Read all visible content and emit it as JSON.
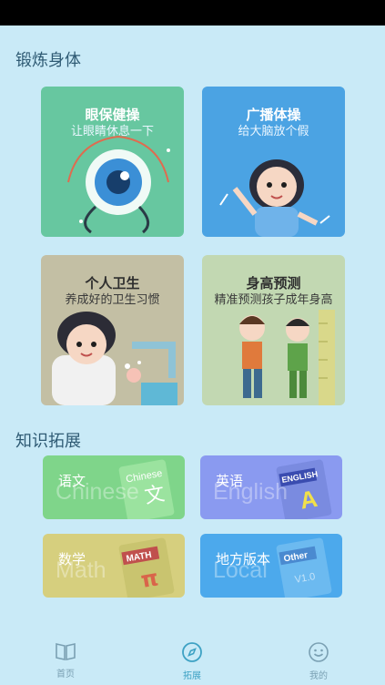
{
  "sections": {
    "exercise_title": "锻炼身体",
    "knowledge_title": "知识拓展"
  },
  "cards": [
    {
      "title": "眼保健操",
      "subtitle": "让眼睛休息一下",
      "color": "#67c7a0"
    },
    {
      "title": "广播体操",
      "subtitle": "给大脑放个假",
      "color": "#4ba3e3"
    },
    {
      "title": "个人卫生",
      "subtitle": "养成好的卫生习惯",
      "color": "#c3bfa4"
    },
    {
      "title": "身高预测",
      "subtitle": "精准预测孩子成年身高",
      "color": "#c2d8b2"
    }
  ],
  "books": [
    {
      "cn": "语文",
      "en": "Chinese",
      "cover": "Chinese",
      "color": "#7fd58a"
    },
    {
      "cn": "英语",
      "en": "English",
      "cover": "ENGLISH",
      "color": "#8a9af0"
    },
    {
      "cn": "数学",
      "en": "Math",
      "cover": "MATH",
      "color": "#d6cf7e"
    },
    {
      "cn": "地方版本",
      "en": "Local",
      "cover": "Other",
      "color": "#4ca9ec"
    }
  ],
  "nav": [
    {
      "label": "首页",
      "icon": "book-icon"
    },
    {
      "label": "拓展",
      "icon": "compass-icon",
      "active": true
    },
    {
      "label": "我的",
      "icon": "smile-icon"
    }
  ]
}
